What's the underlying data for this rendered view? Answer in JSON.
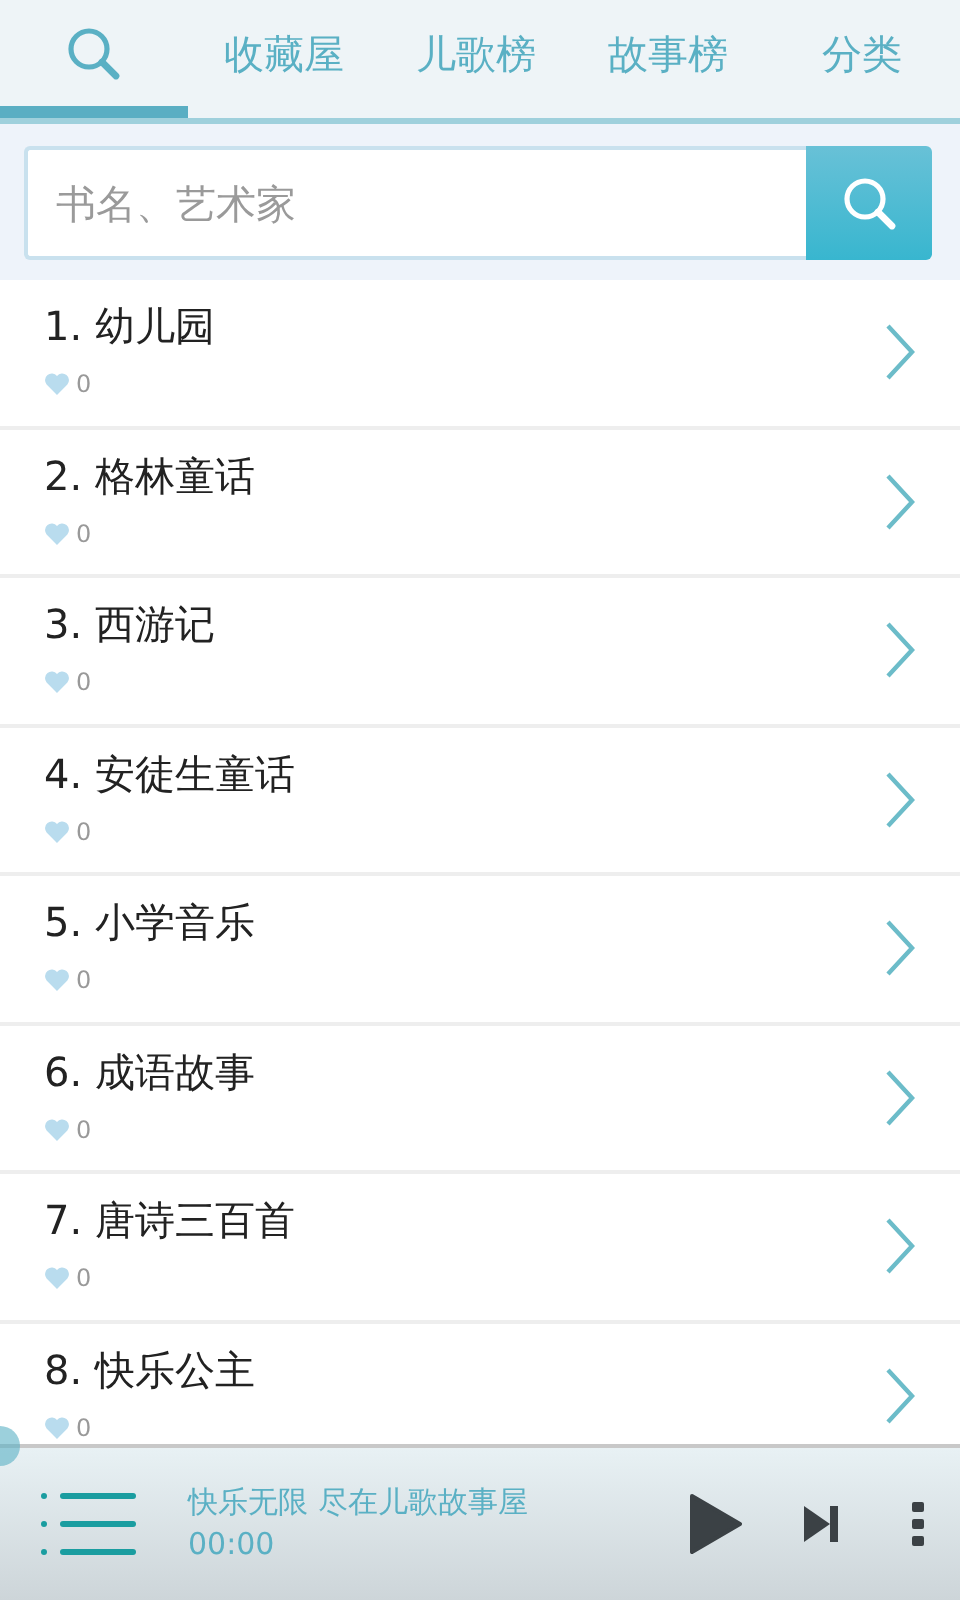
{
  "tabs": [
    {
      "kind": "icon",
      "selected": true
    },
    {
      "kind": "text",
      "label": "收藏屋",
      "selected": false
    },
    {
      "kind": "text",
      "label": "儿歌榜",
      "selected": false
    },
    {
      "kind": "text",
      "label": "故事榜",
      "selected": false
    },
    {
      "kind": "text",
      "label": "分类",
      "selected": false
    }
  ],
  "search": {
    "placeholder": "书名、艺术家"
  },
  "items": [
    {
      "title": "1. 幼儿园",
      "likes": "0"
    },
    {
      "title": "2. 格林童话",
      "likes": "0"
    },
    {
      "title": "3. 西游记",
      "likes": "0"
    },
    {
      "title": "4. 安徒生童话",
      "likes": "0"
    },
    {
      "title": "5. 小学音乐",
      "likes": "0"
    },
    {
      "title": "6. 成语故事",
      "likes": "0"
    },
    {
      "title": "7. 唐诗三百首",
      "likes": "0"
    },
    {
      "title": "8. 快乐公主",
      "likes": "0"
    }
  ],
  "player": {
    "title": "快乐无限 尽在儿歌故事屋",
    "time": "00:00",
    "level": 0
  }
}
